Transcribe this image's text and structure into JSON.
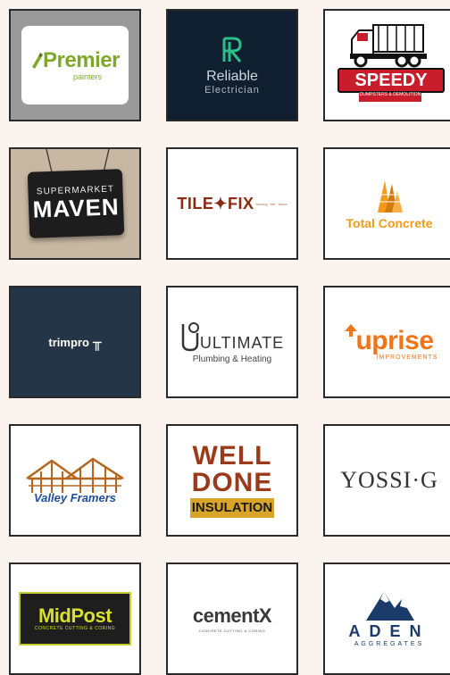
{
  "logos": [
    {
      "id": "premier",
      "name": "Premier",
      "sub": "painters"
    },
    {
      "id": "reliable",
      "name": "Reliable",
      "sub": "Electrician"
    },
    {
      "id": "speedy",
      "name": "SPEEDY",
      "sub": "DUMPSTERS & DEMOLITION"
    },
    {
      "id": "maven",
      "top": "SUPERMARKET",
      "main": "MAVEN"
    },
    {
      "id": "tilefix",
      "name": "TILE✦FIX",
      "sub": "flooring · tile · stone"
    },
    {
      "id": "total",
      "name": "Total Concrete"
    },
    {
      "id": "trimpro",
      "name": "trimpro"
    },
    {
      "id": "ultimate",
      "name": "ULTIMATE",
      "sub": "Plumbing & Heating"
    },
    {
      "id": "uprise",
      "name": "uprise",
      "sub": "IMPROVEMENTS"
    },
    {
      "id": "valley",
      "name": "Valley Framers"
    },
    {
      "id": "welldone",
      "line1": "WELL",
      "line2": "DONE",
      "bar": "INSULATION"
    },
    {
      "id": "yossi",
      "name": "YOSSI·G"
    },
    {
      "id": "midpost",
      "name": "MidPost",
      "sub": "CONCRETE CUTTING & CORING"
    },
    {
      "id": "cementx",
      "name": "cementX",
      "sub": "CONCRETE CUTTING & CORING"
    },
    {
      "id": "aden",
      "name": "ADEN",
      "sub": "AGGREGATES"
    }
  ],
  "colors": {
    "page_bg": "#fbf3ee",
    "card_border": "#2a2a2a",
    "premier_green": "#7ea72c",
    "reliable_bg": "#0f1f30",
    "speedy_red": "#c81d2a",
    "tilefix_brown": "#8c2a12",
    "total_orange": "#f39a1b",
    "trimpro_bg": "#233546",
    "uprise_orange": "#f07418",
    "valley_blue": "#1f4e96",
    "welldone_brown": "#9a3a1a",
    "welldone_gold": "#d9a42a",
    "midpost_yellow": "#d9df30",
    "aden_navy": "#1a3a6a"
  },
  "icons": [
    "paintbrush-icon",
    "rr-monogram-icon",
    "dump-truck-icon",
    "building-icon",
    "trim-t-icon",
    "house-frame-icon",
    "plumbing-u-icon",
    "mountain-icon"
  ]
}
